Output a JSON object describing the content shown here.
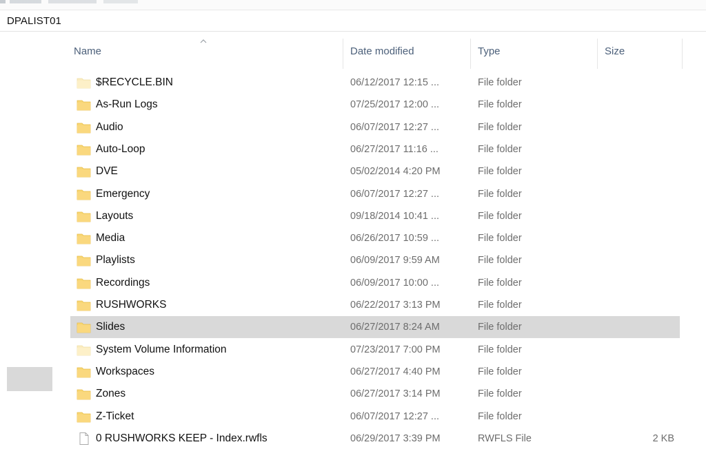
{
  "address": {
    "path": "DPALIST01"
  },
  "columns": {
    "name": "Name",
    "date_modified": "Date modified",
    "type": "Type",
    "size": "Size"
  },
  "colors": {
    "folder": "#f8d775",
    "folder_dark": "#e8bd4a",
    "selection": "#d9d9d9"
  },
  "items": [
    {
      "name": "$RECYCLE.BIN",
      "date": "06/12/2017 12:15 ...",
      "type": "File folder",
      "size": "",
      "icon": "folder-icon",
      "faded": true
    },
    {
      "name": "As-Run Logs",
      "date": "07/25/2017 12:00 ...",
      "type": "File folder",
      "size": "",
      "icon": "folder-icon"
    },
    {
      "name": "Audio",
      "date": "06/07/2017 12:27 ...",
      "type": "File folder",
      "size": "",
      "icon": "folder-icon"
    },
    {
      "name": "Auto-Loop",
      "date": "06/27/2017 11:16 ...",
      "type": "File folder",
      "size": "",
      "icon": "folder-icon"
    },
    {
      "name": "DVE",
      "date": "05/02/2014 4:20 PM",
      "type": "File folder",
      "size": "",
      "icon": "folder-icon"
    },
    {
      "name": "Emergency",
      "date": "06/07/2017 12:27 ...",
      "type": "File folder",
      "size": "",
      "icon": "folder-icon"
    },
    {
      "name": "Layouts",
      "date": "09/18/2014 10:41 ...",
      "type": "File folder",
      "size": "",
      "icon": "folder-icon"
    },
    {
      "name": "Media",
      "date": "06/26/2017 10:59 ...",
      "type": "File folder",
      "size": "",
      "icon": "folder-icon"
    },
    {
      "name": "Playlists",
      "date": "06/09/2017 9:59 AM",
      "type": "File folder",
      "size": "",
      "icon": "folder-icon"
    },
    {
      "name": "Recordings",
      "date": "06/09/2017 10:00 ...",
      "type": "File folder",
      "size": "",
      "icon": "folder-icon"
    },
    {
      "name": "RUSHWORKS",
      "date": "06/22/2017 3:13 PM",
      "type": "File folder",
      "size": "",
      "icon": "folder-icon"
    },
    {
      "name": "Slides",
      "date": "06/27/2017 8:24 AM",
      "type": "File folder",
      "size": "",
      "icon": "folder-icon",
      "selected": true
    },
    {
      "name": "System Volume Information",
      "date": "07/23/2017 7:00 PM",
      "type": "File folder",
      "size": "",
      "icon": "folder-icon",
      "faded": true
    },
    {
      "name": "Workspaces",
      "date": "06/27/2017 4:40 PM",
      "type": "File folder",
      "size": "",
      "icon": "folder-icon"
    },
    {
      "name": "Zones",
      "date": "06/27/2017 3:14 PM",
      "type": "File folder",
      "size": "",
      "icon": "folder-icon"
    },
    {
      "name": "Z-Ticket",
      "date": "06/07/2017 12:27 ...",
      "type": "File folder",
      "size": "",
      "icon": "folder-icon"
    },
    {
      "name": "0 RUSHWORKS KEEP - Index.rwfls",
      "date": "06/29/2017 3:39 PM",
      "type": "RWFLS File",
      "size": "2 KB",
      "icon": "file-icon"
    }
  ]
}
